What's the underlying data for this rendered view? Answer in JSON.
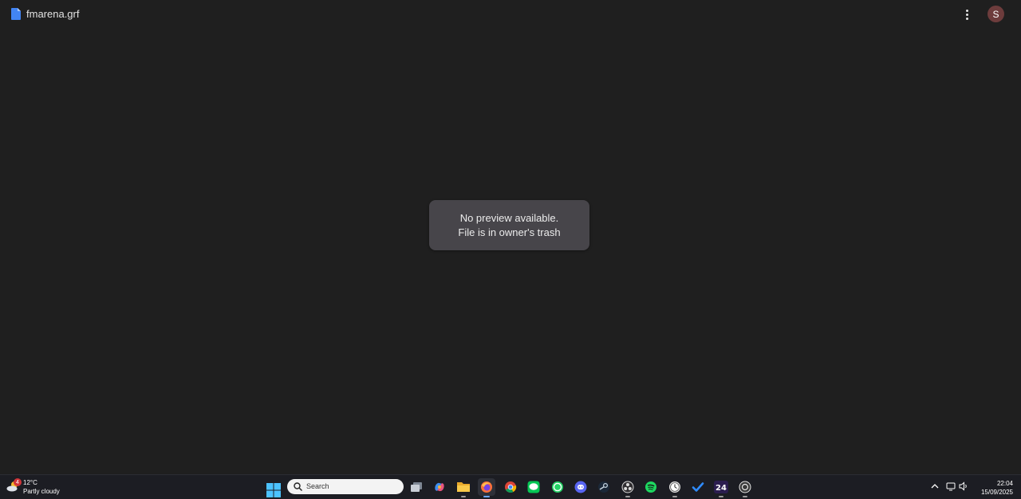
{
  "file": {
    "name": "fmarena.grf"
  },
  "account": {
    "initial": "S",
    "color": "#6d3c3c"
  },
  "preview": {
    "line1": "No preview available.",
    "line2": "File is in owner's trash"
  },
  "taskbar": {
    "weather": {
      "badge": "4",
      "temperature": "12°C",
      "condition": "Partly cloudy"
    },
    "search": {
      "placeholder": "Search"
    },
    "apps": [
      {
        "name": "task-view",
        "icon": "task-view-icon"
      },
      {
        "name": "copilot",
        "icon": "copilot-icon"
      },
      {
        "name": "file-explorer",
        "icon": "folder-icon"
      },
      {
        "name": "firefox",
        "icon": "firefox-icon"
      },
      {
        "name": "chrome",
        "icon": "chrome-icon"
      },
      {
        "name": "line",
        "icon": "line-icon"
      },
      {
        "name": "whatsapp",
        "icon": "whatsapp-icon"
      },
      {
        "name": "discord",
        "icon": "discord-icon"
      },
      {
        "name": "steam",
        "icon": "steam-icon"
      },
      {
        "name": "obs",
        "icon": "obs-icon"
      },
      {
        "name": "spotify",
        "icon": "spotify-icon"
      },
      {
        "name": "clock-app",
        "icon": "clock-app-icon"
      },
      {
        "name": "todo",
        "icon": "checkmark-icon"
      },
      {
        "name": "app-24",
        "icon": "app-24-icon",
        "label": "24"
      },
      {
        "name": "gog-galaxy",
        "icon": "gog-icon"
      }
    ],
    "clock": {
      "time": "22:04",
      "date": "15/09/2025"
    }
  }
}
